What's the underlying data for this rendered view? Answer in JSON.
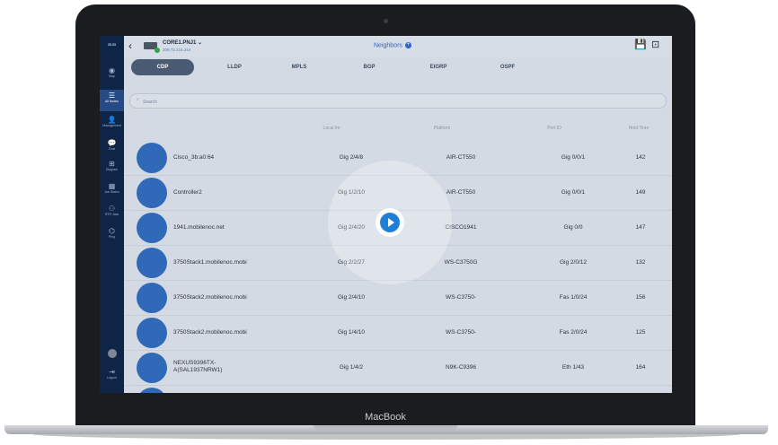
{
  "device": {
    "brand": "MacBook"
  },
  "sidebar": {
    "logo": "ꜳꜳ",
    "items": [
      {
        "label": "Map",
        "glyph": "◉"
      },
      {
        "label": "All Nodes",
        "glyph": "☰"
      },
      {
        "label": "Management",
        "glyph": "👤"
      },
      {
        "label": "Chat",
        "glyph": "💬"
      },
      {
        "label": "Diagram",
        "glyph": "⊞"
      },
      {
        "label": "Job Status",
        "glyph": "▦"
      },
      {
        "label": "RTR Jack",
        "glyph": "⚇"
      },
      {
        "label": "Ping",
        "glyph": "⌬"
      },
      {
        "label": "Logout",
        "glyph": "⇥"
      }
    ]
  },
  "header": {
    "device_name": "CORE1.PNJ1 ⌄",
    "device_ip": "209.72.216.244",
    "title": "Neighbors",
    "plus_glyph": "+",
    "back_glyph": "‹",
    "save_glyph": "💾",
    "export_glyph": "⊡"
  },
  "tabs": [
    "CDP",
    "LLDP",
    "MPLS",
    "BGP",
    "EIGRP",
    "OSPF"
  ],
  "search": {
    "placeholder": "Search",
    "icon": "search-icon"
  },
  "columns": [
    "Local Int",
    "Platform",
    "Port ID",
    "Hold Time"
  ],
  "rows": [
    {
      "name": "Cisco_3b:a0:64",
      "local": "Gig 2/4/8",
      "platform": "AIR-CT550",
      "port": "Gig 0/0/1",
      "hold": "142"
    },
    {
      "name": "Controller2",
      "local": "Gig 1/2/10",
      "platform": "AIR-CT550",
      "port": "Gig 0/0/1",
      "hold": "149"
    },
    {
      "name": "1941.mobilenoc.net",
      "local": "Gig 2/4/20",
      "platform": "CISCO1941",
      "port": "Gig 0/0",
      "hold": "147"
    },
    {
      "name": "3750Stack1.mobilenoc.mobi",
      "local": "Gig 2/2/27",
      "platform": "WS-C3750G",
      "port": "Gig 2/0/12",
      "hold": "132"
    },
    {
      "name": "3750Stack2.mobilenoc.mobi",
      "local": "Gig 2/4/10",
      "platform": "WS-C3750-",
      "port": "Fas 1/0/24",
      "hold": "156"
    },
    {
      "name": "3750Stack2.mobilenoc.mobi",
      "local": "Gig 1/4/10",
      "platform": "WS-C3750-",
      "port": "Fas 2/0/24",
      "hold": "125"
    },
    {
      "name": "NEXUS9396TX-\nA(SAL1937NRW1)",
      "local": "Gig 1/4/2",
      "platform": "N9K-C9396",
      "port": "Eth 1/43",
      "hold": "164"
    }
  ],
  "colors": {
    "accent": "#2b64c9",
    "sidebar": "#0f2547",
    "play": "#1e7fd6"
  }
}
